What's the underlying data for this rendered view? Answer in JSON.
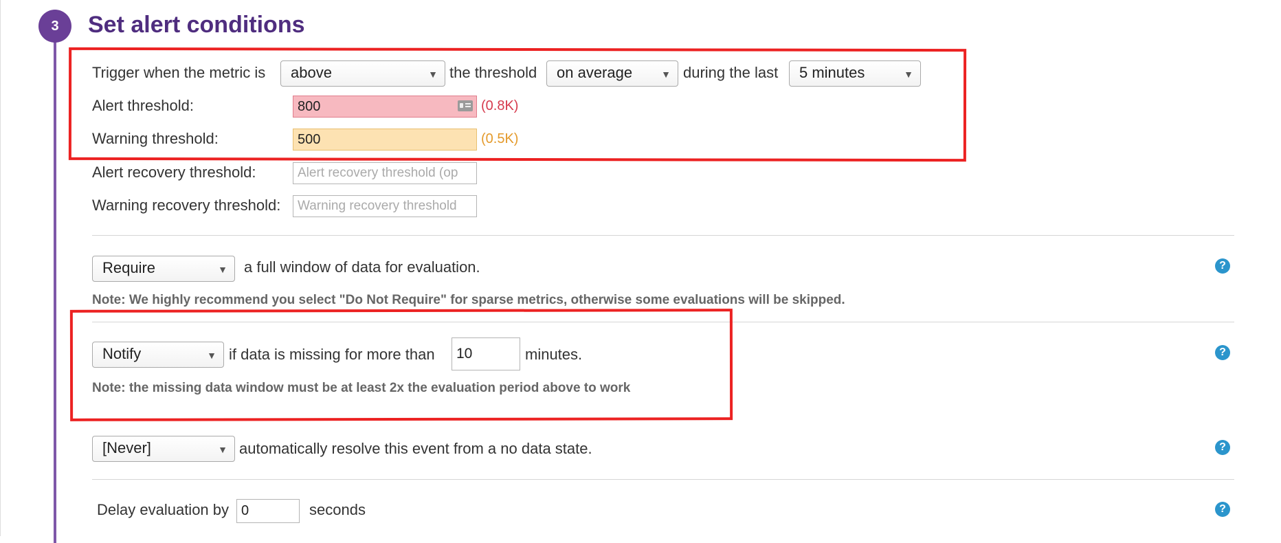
{
  "step": {
    "number": "3",
    "title": "Set alert conditions"
  },
  "trigger": {
    "prefix": "Trigger when the metric is",
    "comparator": "above",
    "middle": "the threshold",
    "aggregation": "on average",
    "during": "during the last",
    "window": "5 minutes"
  },
  "thresholds": {
    "alert_label": "Alert threshold:",
    "alert_value": "800",
    "alert_hint": "(0.8K)",
    "warning_label": "Warning threshold:",
    "warning_value": "500",
    "warning_hint": "(0.5K)",
    "alert_recovery_label": "Alert recovery threshold:",
    "alert_recovery_placeholder": "Alert recovery threshold (op",
    "warning_recovery_label": "Warning recovery threshold:",
    "warning_recovery_placeholder": "Warning recovery threshold"
  },
  "require": {
    "value": "Require",
    "text": "a full window of data for evaluation.",
    "note": "Note: We highly recommend you select \"Do Not Require\" for sparse metrics, otherwise some evaluations will be skipped."
  },
  "missing": {
    "value": "Notify",
    "text": "if data is missing for more than",
    "minutes_value": "10",
    "suffix": "minutes.",
    "note": "Note: the missing data window must be at least 2x the evaluation period above to work"
  },
  "resolve": {
    "value": "[Never]",
    "text": "automatically resolve this event from a no data state."
  },
  "delay": {
    "prefix": "Delay evaluation by",
    "value": "0",
    "suffix": "seconds"
  },
  "icons": {
    "help": "?",
    "dropdown": "▼"
  },
  "colors": {
    "accent_purple": "#4f2d7f",
    "alert_red": "#d63a4d",
    "warning_orange": "#e49a2b",
    "help_blue": "#2b95cc",
    "annotation_red": "#ec2222"
  }
}
